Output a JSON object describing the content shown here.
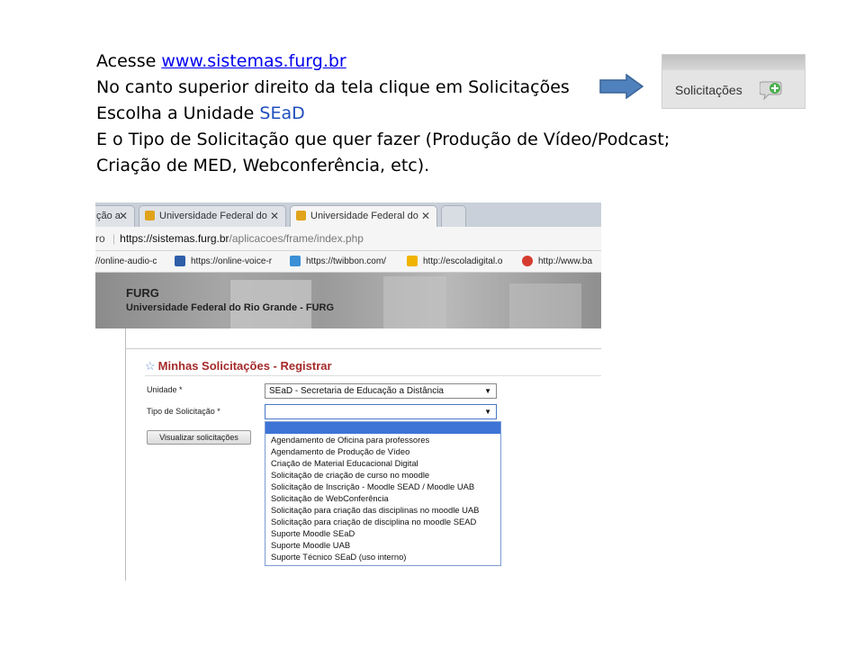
{
  "instructions": {
    "line1_prefix": "Acesse ",
    "line1_link": "www.sistemas.furg.br",
    "line2": "No canto superior direito da tela clique em  Solicitações",
    "line3_prefix": "Escolha a Unidade ",
    "line3_highlight": "SEaD",
    "line4": "E o Tipo de Solicitação que quer fazer (Produção de Vídeo/Podcast;",
    "line5": "Criação de MED, Webconferência, etc)."
  },
  "inset": {
    "label": "Solicitações",
    "icon": "speech-bubble-plus-icon"
  },
  "browser": {
    "tabs": [
      {
        "label": "ção a"
      },
      {
        "label": "Universidade Federal do"
      },
      {
        "label": "Universidade Federal do"
      }
    ],
    "address": {
      "prefix": "ro",
      "host": "https://sistemas.furg.br",
      "path": "/aplicacoes/frame/index.php"
    },
    "bookmarks": [
      "//online-audio-c",
      "https://online-voice-r",
      "https://twibbon.com/",
      "http://escoladigital.o",
      "http://www.ba"
    ],
    "banner": {
      "title": "FURG",
      "subtitle": "Universidade Federal do Rio Grande - FURG"
    }
  },
  "form": {
    "title": "Minhas Solicitações - Registrar",
    "unidade_label": "Unidade *",
    "unidade_value": "SEaD - Secretaria de Educação a Distância",
    "tipo_label": "Tipo de Solicitação *",
    "tipo_value": "",
    "view_button": "Visualizar solicitações",
    "options": [
      "Agendamento de Oficina para professores",
      "Agendamento de Produção de Vídeo",
      "Criação de Material Educacional Digital",
      "Solicitação de criação de curso no moodle",
      "Solicitação de Inscrição - Moodle SEAD / Moodle UAB",
      "Solicitação de WebConferência",
      "Solicitação para criação das disciplinas no moodle UAB",
      "Solicitação para criação de disciplina no moodle SEAD",
      "Suporte Moodle SEaD",
      "Suporte Moodle UAB",
      "Suporte Técnico SEaD (uso interno)"
    ]
  },
  "colors": {
    "arrow": "#4f81bd",
    "link": "#0000ee",
    "form_title": "#a52a2a",
    "highlight": "#3d74d6"
  }
}
